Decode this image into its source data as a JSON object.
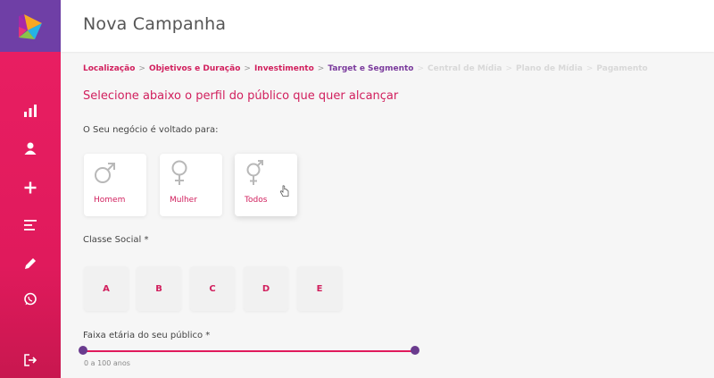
{
  "header": {
    "title": "Nova Campanha"
  },
  "breadcrumb": [
    {
      "label": "Localização",
      "state": "done"
    },
    {
      "label": "Objetivos e Duração",
      "state": "done"
    },
    {
      "label": "Investimento",
      "state": "done"
    },
    {
      "label": "Target e Segmento",
      "state": "current"
    },
    {
      "label": "Central de Mídia",
      "state": "todo"
    },
    {
      "label": "Plano de Mídia",
      "state": "todo"
    },
    {
      "label": "Pagamento",
      "state": "todo"
    }
  ],
  "breadcrumb_separator": ">",
  "main": {
    "heading": "Selecione abaixo o perfil do público que quer alcançar",
    "business_question": "O Seu negócio é voltado para:",
    "gender_options": [
      {
        "label": "Homem",
        "icon": "male-icon"
      },
      {
        "label": "Mulher",
        "icon": "female-icon"
      },
      {
        "label": "Todos",
        "icon": "male-female-icon"
      }
    ],
    "social_class_label": "Classe Social *",
    "social_classes": [
      "A",
      "B",
      "C",
      "D",
      "E"
    ],
    "age_label": "Faixa etária do seu público *",
    "age_range": {
      "min": 0,
      "max": 100,
      "text": "0 a 100 anos"
    }
  },
  "sidebar": {
    "icons": [
      "bar-chart-icon",
      "user-icon",
      "plus-icon",
      "menu-lines-icon",
      "pencil-icon",
      "whatsapp-icon"
    ],
    "logout_icon": "logout-icon"
  },
  "colors": {
    "accent": "#e01a5c",
    "sidebar_top": "#6f3fa6",
    "current_step": "#7a3a9c",
    "slider_handle": "#6a3b8e"
  }
}
